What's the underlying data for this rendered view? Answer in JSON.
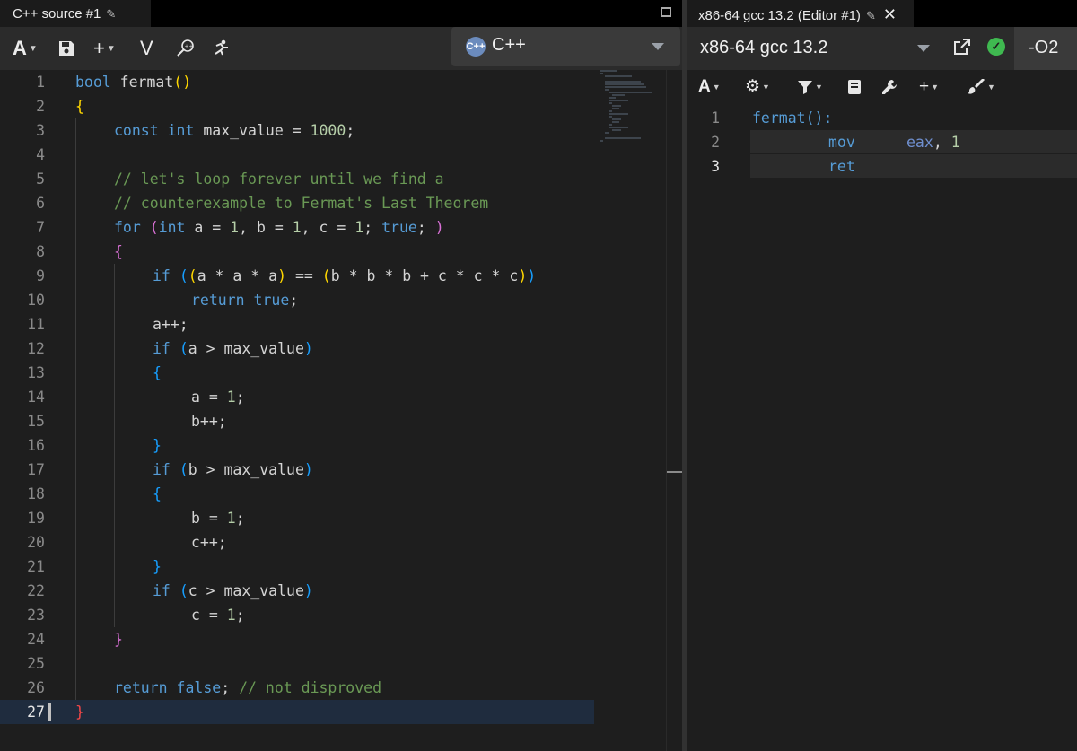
{
  "source_pane": {
    "tab_title": "C++ source #1",
    "pencil_icon": "pencil-icon",
    "toolbar": {
      "font_button": "A",
      "save_icon": "floppy-disk-icon",
      "add_button": "+",
      "vim_button": "V",
      "cppinsights_icon": "magnifier-icon",
      "quickbench_icon": "runner-icon"
    },
    "language": {
      "name": "C++",
      "icon": "cpp-logo-icon",
      "icon_text": "C++"
    },
    "code_lines": [
      {
        "num": "1"
      },
      {
        "num": "2"
      },
      {
        "num": "3"
      },
      {
        "num": "4"
      },
      {
        "num": "5"
      },
      {
        "num": "6"
      },
      {
        "num": "7"
      },
      {
        "num": "8"
      },
      {
        "num": "9"
      },
      {
        "num": "10"
      },
      {
        "num": "11"
      },
      {
        "num": "12"
      },
      {
        "num": "13"
      },
      {
        "num": "14"
      },
      {
        "num": "15"
      },
      {
        "num": "16"
      },
      {
        "num": "17"
      },
      {
        "num": "18"
      },
      {
        "num": "19"
      },
      {
        "num": "20"
      },
      {
        "num": "21"
      },
      {
        "num": "22"
      },
      {
        "num": "23"
      },
      {
        "num": "24"
      },
      {
        "num": "25"
      },
      {
        "num": "26"
      },
      {
        "num": "27"
      }
    ],
    "tokens": {
      "l1": [
        "bool",
        " fermat",
        "(",
        ")"
      ],
      "l2": [
        "{"
      ],
      "l3": [
        "const",
        " ",
        "int",
        " max_value = ",
        "1000",
        ";"
      ],
      "l5": [
        "// let's loop forever until we find a"
      ],
      "l6": [
        "// counterexample to Fermat's Last Theorem"
      ],
      "l7": [
        "for",
        " ",
        "(",
        "int",
        " a = ",
        "1",
        ", b = ",
        "1",
        ", c = ",
        "1",
        "; ",
        "true",
        "; ",
        ")"
      ],
      "l8": [
        "{"
      ],
      "l9": [
        "if",
        " ",
        "(",
        "(",
        "a * a * a",
        ")",
        " == ",
        "(",
        "b * b * b + c * c * c",
        ")",
        ")"
      ],
      "l10": [
        "return",
        " ",
        "true",
        ";"
      ],
      "l11": [
        "a++;"
      ],
      "l12": [
        "if",
        " ",
        "(",
        "a > max_value",
        ")"
      ],
      "l13": [
        "{"
      ],
      "l14": [
        "a = ",
        "1",
        ";"
      ],
      "l15": [
        "b++;"
      ],
      "l16": [
        "}"
      ],
      "l17": [
        "if",
        " ",
        "(",
        "b > max_value",
        ")"
      ],
      "l18": [
        "{"
      ],
      "l19": [
        "b = ",
        "1",
        ";"
      ],
      "l20": [
        "c++;"
      ],
      "l21": [
        "}"
      ],
      "l22": [
        "if",
        " ",
        "(",
        "c > max_value",
        ")"
      ],
      "l23": [
        "c = ",
        "1",
        ";"
      ],
      "l24": [
        "}"
      ],
      "l26": [
        "return",
        " ",
        "false",
        "; ",
        "// not disproved"
      ],
      "l27": [
        "}"
      ]
    }
  },
  "compiler_pane": {
    "tab_title": "x86-64 gcc 13.2 (Editor #1)",
    "compiler_name": "x86-64 gcc 13.2",
    "options": "-O2",
    "status_icon": "check-circle-icon",
    "toolbar": {
      "font_button": "A",
      "add_button": "+"
    },
    "asm_lines": [
      {
        "num": "1",
        "label": "fermat():"
      },
      {
        "num": "2",
        "op": "mov",
        "args_reg": "eax",
        "args_sep": ", ",
        "args_imm": "1"
      },
      {
        "num": "3",
        "op": "ret"
      }
    ]
  },
  "colors": {
    "background": "#1e1e1e",
    "keyword": "#569cd6",
    "comment": "#6a9955",
    "number": "#b5cea8",
    "bracket_gold": "#ffd700",
    "bracket_purple": "#da70d6",
    "bracket_blue": "#179fff",
    "active_line": "#1f2c3e",
    "status_ok": "#3fb950"
  }
}
